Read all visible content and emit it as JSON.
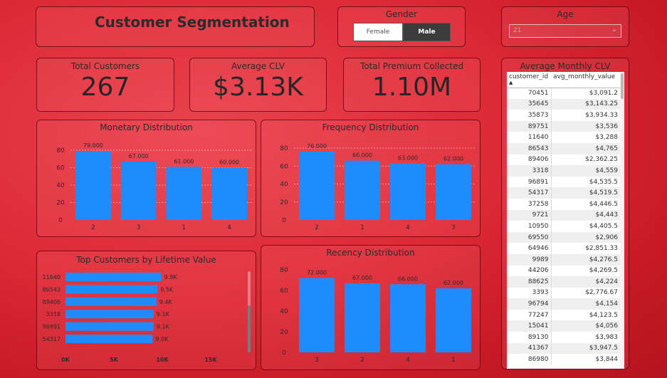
{
  "title": "Customer Segmentation",
  "gender": {
    "label": "Gender",
    "options": [
      "Female",
      "Male"
    ],
    "selected": "Male"
  },
  "age": {
    "label": "Age",
    "value": "21"
  },
  "kpis": {
    "total_customers": {
      "label": "Total Customers",
      "value": "267"
    },
    "avg_clv": {
      "label": "Average CLV",
      "value": "$3.13K"
    },
    "premium": {
      "label": "Total Premium Collected",
      "value": "1.10M"
    }
  },
  "icons": {
    "dropdown": "chevron-down-icon",
    "sort": "sort-ascending-icon"
  },
  "colors": {
    "bar": "#1e8cff",
    "accent": "#d92632"
  },
  "chart_data": [
    {
      "id": "monetary",
      "type": "bar",
      "title": "Monetary Distribution",
      "categories": [
        "2",
        "3",
        "1",
        "4"
      ],
      "values": [
        79,
        67,
        61,
        60
      ],
      "labels": [
        "79.000",
        "67.000",
        "61.000",
        "60.000"
      ],
      "yticks": [
        "0",
        "20",
        "40",
        "60",
        "80"
      ],
      "ylim": [
        0,
        80
      ],
      "grid": true
    },
    {
      "id": "frequency",
      "type": "bar",
      "title": "Frequency Distribution",
      "categories": [
        "2",
        "1",
        "4",
        "3"
      ],
      "values": [
        76,
        66,
        63,
        62
      ],
      "labels": [
        "76.000",
        "66.000",
        "63.000",
        "62.000"
      ],
      "yticks": [
        "0",
        "20",
        "40",
        "60",
        "80"
      ],
      "ylim": [
        0,
        80
      ],
      "grid": true
    },
    {
      "id": "recency",
      "type": "bar",
      "title": "Recency Distribution",
      "categories": [
        "3",
        "2",
        "4",
        "1"
      ],
      "values": [
        72,
        67,
        66,
        62
      ],
      "labels": [
        "72.000",
        "67.000",
        "66.000",
        "62.000"
      ],
      "yticks": [
        "0",
        "20",
        "40",
        "60",
        "80"
      ],
      "ylim": [
        0,
        80
      ],
      "grid": false
    },
    {
      "id": "top",
      "type": "bar",
      "orientation": "horizontal",
      "title": "Top Customers by Lifetime Value",
      "categories": [
        "11640",
        "86543",
        "89406",
        "3318",
        "96891",
        "54317"
      ],
      "values": [
        9.9,
        9.5,
        9.4,
        9.1,
        9.1,
        9.0
      ],
      "labels": [
        "9.9K",
        "9.5K",
        "9.4K",
        "9.1K",
        "9.1K",
        "9.0K"
      ],
      "xticks": [
        "0K",
        "5K",
        "10K",
        "15K"
      ],
      "xlim": [
        0,
        15
      ]
    }
  ],
  "table": {
    "title": "Average Monthly CLV",
    "columns": [
      "customer_id",
      "avg_monthly_value"
    ],
    "rows": [
      [
        "70451",
        "$3,091.2"
      ],
      [
        "35645",
        "$3,143.25"
      ],
      [
        "35873",
        "$3,934.33"
      ],
      [
        "89751",
        "$3,536"
      ],
      [
        "11640",
        "$3,288"
      ],
      [
        "86543",
        "$4,765"
      ],
      [
        "89406",
        "$2,362.25"
      ],
      [
        "3318",
        "$4,559"
      ],
      [
        "96891",
        "$4,535.5"
      ],
      [
        "54317",
        "$4,519.5"
      ],
      [
        "37258",
        "$4,446.5"
      ],
      [
        "9721",
        "$4,443"
      ],
      [
        "10950",
        "$4,405.5"
      ],
      [
        "69550",
        "$2,906"
      ],
      [
        "64946",
        "$2,851.33"
      ],
      [
        "9989",
        "$4,276.5"
      ],
      [
        "44206",
        "$4,269.5"
      ],
      [
        "88625",
        "$4,224"
      ],
      [
        "3393",
        "$2,776.67"
      ],
      [
        "96794",
        "$4,154"
      ],
      [
        "77247",
        "$4,123.5"
      ],
      [
        "15041",
        "$4,056"
      ],
      [
        "89130",
        "$3,983"
      ],
      [
        "41367",
        "$3,947.5"
      ],
      [
        "86980",
        "$3,844"
      ]
    ]
  }
}
